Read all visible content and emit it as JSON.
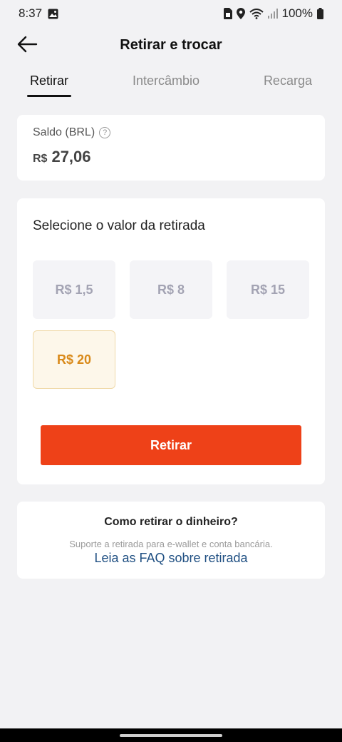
{
  "status_bar": {
    "time": "8:37",
    "battery": "100%",
    "icons": [
      "image-icon",
      "sim-icon",
      "location-icon",
      "wifi-icon",
      "signal-icon",
      "battery-icon"
    ]
  },
  "header": {
    "title": "Retirar e trocar",
    "back_icon": "arrow-left-icon"
  },
  "tabs": [
    {
      "label": "Retirar",
      "active": true
    },
    {
      "label": "Intercâmbio",
      "active": false
    },
    {
      "label": "Recarga",
      "active": false
    }
  ],
  "balance": {
    "label": "Saldo (BRL)",
    "currency": "R$",
    "amount": "27,06"
  },
  "withdraw": {
    "title": "Selecione o valor da retirada",
    "options": [
      {
        "label": "R$ 1,5",
        "selected": false
      },
      {
        "label": "R$ 8",
        "selected": false
      },
      {
        "label": "R$ 15",
        "selected": false
      },
      {
        "label": "R$ 20",
        "selected": true
      }
    ],
    "button_label": "Retirar"
  },
  "help": {
    "title": "Como retirar o dinheiro?",
    "subtitle": "Suporte a retirada para e-wallet e conta bancária.",
    "link": "Leia as FAQ sobre retirada"
  },
  "colors": {
    "accent": "#ee4118",
    "selected_text": "#d98a1a",
    "link": "#1f4f82"
  }
}
